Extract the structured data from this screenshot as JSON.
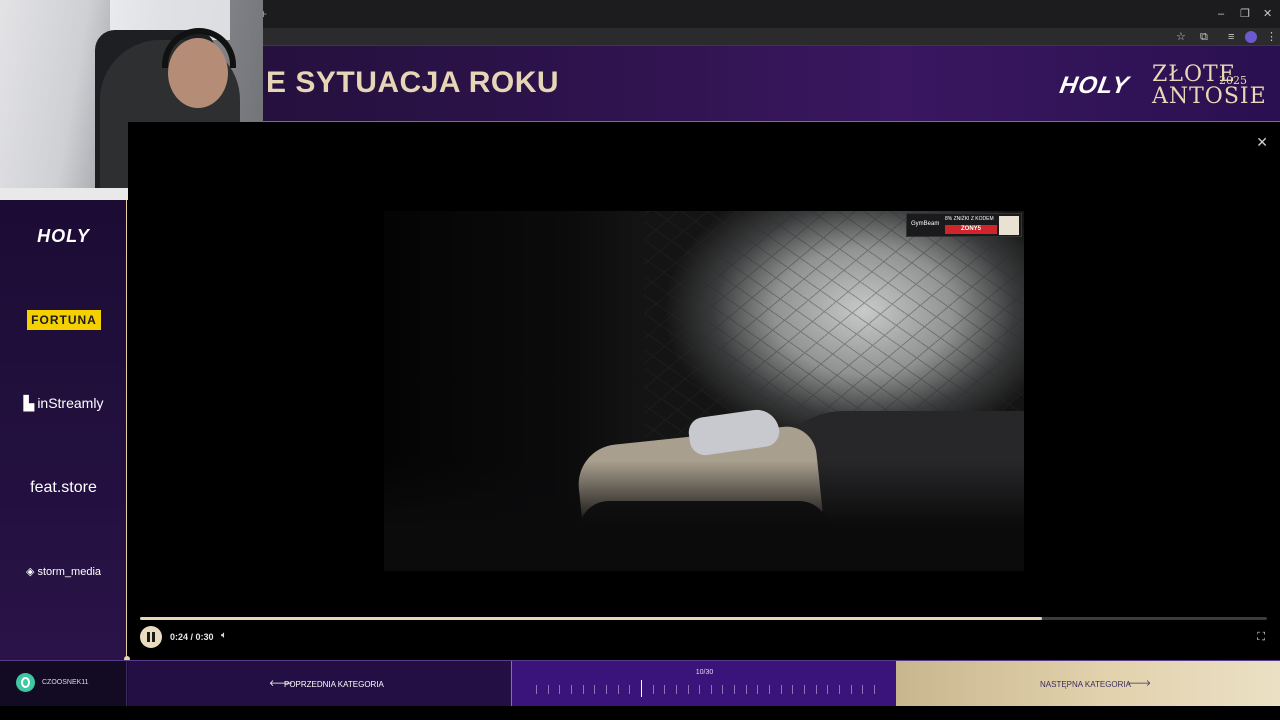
{
  "browser": {
    "new_tab_symbol": "+",
    "window_minimize": "–",
    "window_restore": "❐",
    "window_close": "✕",
    "toolbar_icons": [
      "star-icon",
      "extensions-icon",
      "media-icon",
      "profile-icon",
      "menu-icon"
    ]
  },
  "header": {
    "category_title": "E SYTUACJA ROKU",
    "logo_holy": "HOLY",
    "logo_line1": "ZŁOTE",
    "logo_line2": "ANTOSIE",
    "logo_year": "2025"
  },
  "sponsors": {
    "holy": "HOLY",
    "fortuna": "FORTUNA",
    "instreamly": "inStreamly",
    "feat": "feat.store",
    "storm": "storm_media"
  },
  "video": {
    "ad_brand": "GymBeam",
    "ad_text": "8% ZNIŻKI Z KODEM",
    "ad_code": "ZONY5",
    "time": "0:24 / 0:30",
    "progress_fraction": 0.8
  },
  "footer": {
    "username": "CZOOSNEK11",
    "prev_label": "POPRZEDNIA KATEGORIA",
    "next_label": "NASTĘPNA KATEGORIA",
    "counter": "10/30",
    "current_index": 10,
    "total": 30
  },
  "colors": {
    "accent_gold": "#e6d8b4",
    "header_purple": "#2b1248",
    "sidebar_purple": "#23103f",
    "progress_purple": "#3a147a"
  }
}
